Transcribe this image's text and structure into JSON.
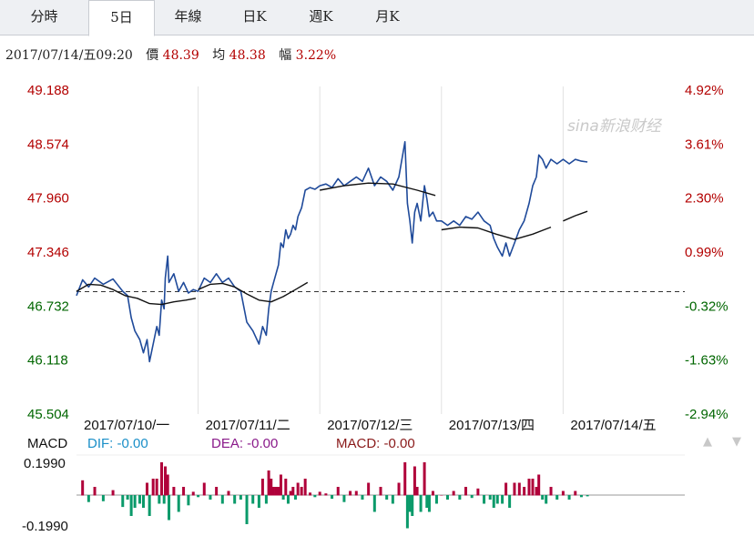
{
  "tabs": [
    {
      "label": "分時",
      "active": false
    },
    {
      "label": "5日",
      "active": true
    },
    {
      "label": "年線",
      "active": false
    },
    {
      "label": "日K",
      "active": false
    },
    {
      "label": "週K",
      "active": false
    },
    {
      "label": "月K",
      "active": false
    }
  ],
  "info": {
    "datetime": "2017/07/14/五09:20",
    "price_label": "價",
    "price": "48.39",
    "avg_label": "均",
    "avg": "48.38",
    "range_label": "幅",
    "range": "3.22%"
  },
  "watermark": "sina新浪财经",
  "colors": {
    "up": "#b30000",
    "down": "#006600",
    "line": "#1f4a9a",
    "avg": "#111111",
    "macd_pos": "#b0003a",
    "macd_neg": "#0a9a6a",
    "dif": "#1a8fc8",
    "dea": "#8a1a8a"
  },
  "macd": {
    "title": "MACD",
    "dif": "DIF: -0.00",
    "dea": "DEA: -0.00",
    "macd": "MACD: -0.00",
    "ymax_label": "0.1990",
    "ymin_label": "-0.1990"
  },
  "chart_data": {
    "type": "line",
    "title": "",
    "xlabel": "",
    "ylabel": "",
    "ylim": [
      45.504,
      49.188
    ],
    "prev_close": 46.896,
    "y_ticks": [
      "49.188",
      "48.574",
      "47.960",
      "47.346",
      "46.732",
      "46.118",
      "45.504"
    ],
    "pct_ticks": [
      "4.92%",
      "3.61%",
      "2.30%",
      "0.99%",
      "-0.32%",
      "-1.63%",
      "-2.94%"
    ],
    "days": [
      "2017/07/10/一",
      "2017/07/11/二",
      "2017/07/12/三",
      "2017/07/13/四",
      "2017/07/14/五"
    ],
    "x_range": [
      0,
      5
    ],
    "grid": true,
    "series": [
      {
        "values": [
          [
            0.0,
            46.85
          ],
          [
            0.05,
            47.03
          ],
          [
            0.1,
            46.95
          ],
          [
            0.15,
            47.05
          ],
          [
            0.22,
            46.98
          ],
          [
            0.3,
            47.04
          ],
          [
            0.38,
            46.9
          ],
          [
            0.42,
            46.85
          ],
          [
            0.45,
            46.6
          ],
          [
            0.48,
            46.45
          ],
          [
            0.52,
            46.35
          ],
          [
            0.55,
            46.2
          ],
          [
            0.58,
            46.35
          ],
          [
            0.6,
            46.1
          ],
          [
            0.63,
            46.3
          ],
          [
            0.66,
            46.5
          ],
          [
            0.68,
            46.4
          ],
          [
            0.7,
            46.8
          ],
          [
            0.72,
            46.7
          ],
          [
            0.73,
            47.05
          ],
          [
            0.75,
            47.3
          ],
          [
            0.76,
            47.0
          ],
          [
            0.8,
            47.1
          ],
          [
            0.84,
            46.9
          ],
          [
            0.88,
            47.0
          ],
          [
            0.92,
            46.88
          ],
          [
            0.96,
            46.92
          ],
          [
            1.0,
            46.9
          ],
          [
            1.05,
            47.05
          ],
          [
            1.1,
            47.0
          ],
          [
            1.15,
            47.1
          ],
          [
            1.2,
            47.0
          ],
          [
            1.25,
            47.05
          ],
          [
            1.3,
            46.95
          ],
          [
            1.35,
            46.9
          ],
          [
            1.4,
            46.55
          ],
          [
            1.45,
            46.45
          ],
          [
            1.5,
            46.3
          ],
          [
            1.53,
            46.5
          ],
          [
            1.56,
            46.4
          ],
          [
            1.58,
            46.7
          ],
          [
            1.6,
            46.9
          ],
          [
            1.62,
            47.0
          ],
          [
            1.64,
            47.1
          ],
          [
            1.66,
            47.2
          ],
          [
            1.68,
            47.45
          ],
          [
            1.7,
            47.4
          ],
          [
            1.72,
            47.6
          ],
          [
            1.74,
            47.5
          ],
          [
            1.76,
            47.55
          ],
          [
            1.78,
            47.65
          ],
          [
            1.8,
            47.6
          ],
          [
            1.82,
            47.75
          ],
          [
            1.85,
            47.85
          ],
          [
            1.88,
            48.05
          ],
          [
            1.92,
            48.08
          ],
          [
            1.96,
            48.06
          ],
          [
            2.0,
            48.1
          ],
          [
            2.05,
            48.12
          ],
          [
            2.1,
            48.08
          ],
          [
            2.15,
            48.18
          ],
          [
            2.2,
            48.1
          ],
          [
            2.25,
            48.15
          ],
          [
            2.3,
            48.2
          ],
          [
            2.35,
            48.15
          ],
          [
            2.4,
            48.3
          ],
          [
            2.45,
            48.1
          ],
          [
            2.5,
            48.2
          ],
          [
            2.55,
            48.15
          ],
          [
            2.6,
            48.05
          ],
          [
            2.65,
            48.2
          ],
          [
            2.7,
            48.6
          ],
          [
            2.72,
            47.9
          ],
          [
            2.74,
            47.7
          ],
          [
            2.76,
            47.45
          ],
          [
            2.78,
            47.8
          ],
          [
            2.8,
            47.9
          ],
          [
            2.83,
            47.7
          ],
          [
            2.86,
            48.1
          ],
          [
            2.88,
            47.95
          ],
          [
            2.9,
            47.75
          ],
          [
            2.93,
            47.8
          ],
          [
            2.96,
            47.7
          ],
          [
            3.0,
            47.7
          ],
          [
            3.05,
            47.65
          ],
          [
            3.1,
            47.7
          ],
          [
            3.15,
            47.65
          ],
          [
            3.2,
            47.75
          ],
          [
            3.25,
            47.72
          ],
          [
            3.3,
            47.8
          ],
          [
            3.35,
            47.7
          ],
          [
            3.4,
            47.65
          ],
          [
            3.43,
            47.5
          ],
          [
            3.46,
            47.4
          ],
          [
            3.5,
            47.3
          ],
          [
            3.53,
            47.45
          ],
          [
            3.56,
            47.3
          ],
          [
            3.6,
            47.45
          ],
          [
            3.64,
            47.6
          ],
          [
            3.68,
            47.7
          ],
          [
            3.72,
            47.9
          ],
          [
            3.75,
            48.1
          ],
          [
            3.78,
            48.2
          ],
          [
            3.8,
            48.45
          ],
          [
            3.83,
            48.4
          ],
          [
            3.86,
            48.3
          ],
          [
            3.9,
            48.4
          ],
          [
            3.95,
            48.35
          ],
          [
            4.0,
            48.4
          ],
          [
            4.05,
            48.35
          ],
          [
            4.1,
            48.4
          ],
          [
            4.15,
            48.38
          ],
          [
            4.2,
            48.37
          ]
        ]
      },
      {
        "values": [
          [
            0.0,
            46.9
          ],
          [
            0.1,
            46.98
          ],
          [
            0.2,
            46.97
          ],
          [
            0.3,
            46.92
          ],
          [
            0.4,
            46.85
          ],
          [
            0.5,
            46.82
          ],
          [
            0.6,
            46.76
          ],
          [
            0.7,
            46.75
          ],
          [
            0.8,
            46.78
          ],
          [
            0.9,
            46.8
          ],
          [
            0.98,
            46.82
          ],
          [
            1.0,
            46.92
          ],
          [
            1.1,
            46.98
          ],
          [
            1.2,
            46.99
          ],
          [
            1.3,
            46.95
          ],
          [
            1.4,
            46.87
          ],
          [
            1.5,
            46.8
          ],
          [
            1.6,
            46.78
          ],
          [
            1.7,
            46.84
          ],
          [
            1.8,
            46.92
          ],
          [
            1.9,
            47.0
          ],
          [
            2.0,
            48.05
          ],
          [
            2.2,
            48.1
          ],
          [
            2.4,
            48.13
          ],
          [
            2.6,
            48.12
          ],
          [
            2.8,
            48.05
          ],
          [
            2.95,
            47.99
          ],
          [
            3.0,
            47.6
          ],
          [
            3.15,
            47.63
          ],
          [
            3.3,
            47.62
          ],
          [
            3.45,
            47.55
          ],
          [
            3.6,
            47.49
          ],
          [
            3.75,
            47.55
          ],
          [
            3.9,
            47.63
          ],
          [
            4.0,
            47.7
          ],
          [
            4.1,
            47.76
          ],
          [
            4.2,
            47.81
          ]
        ]
      }
    ]
  }
}
